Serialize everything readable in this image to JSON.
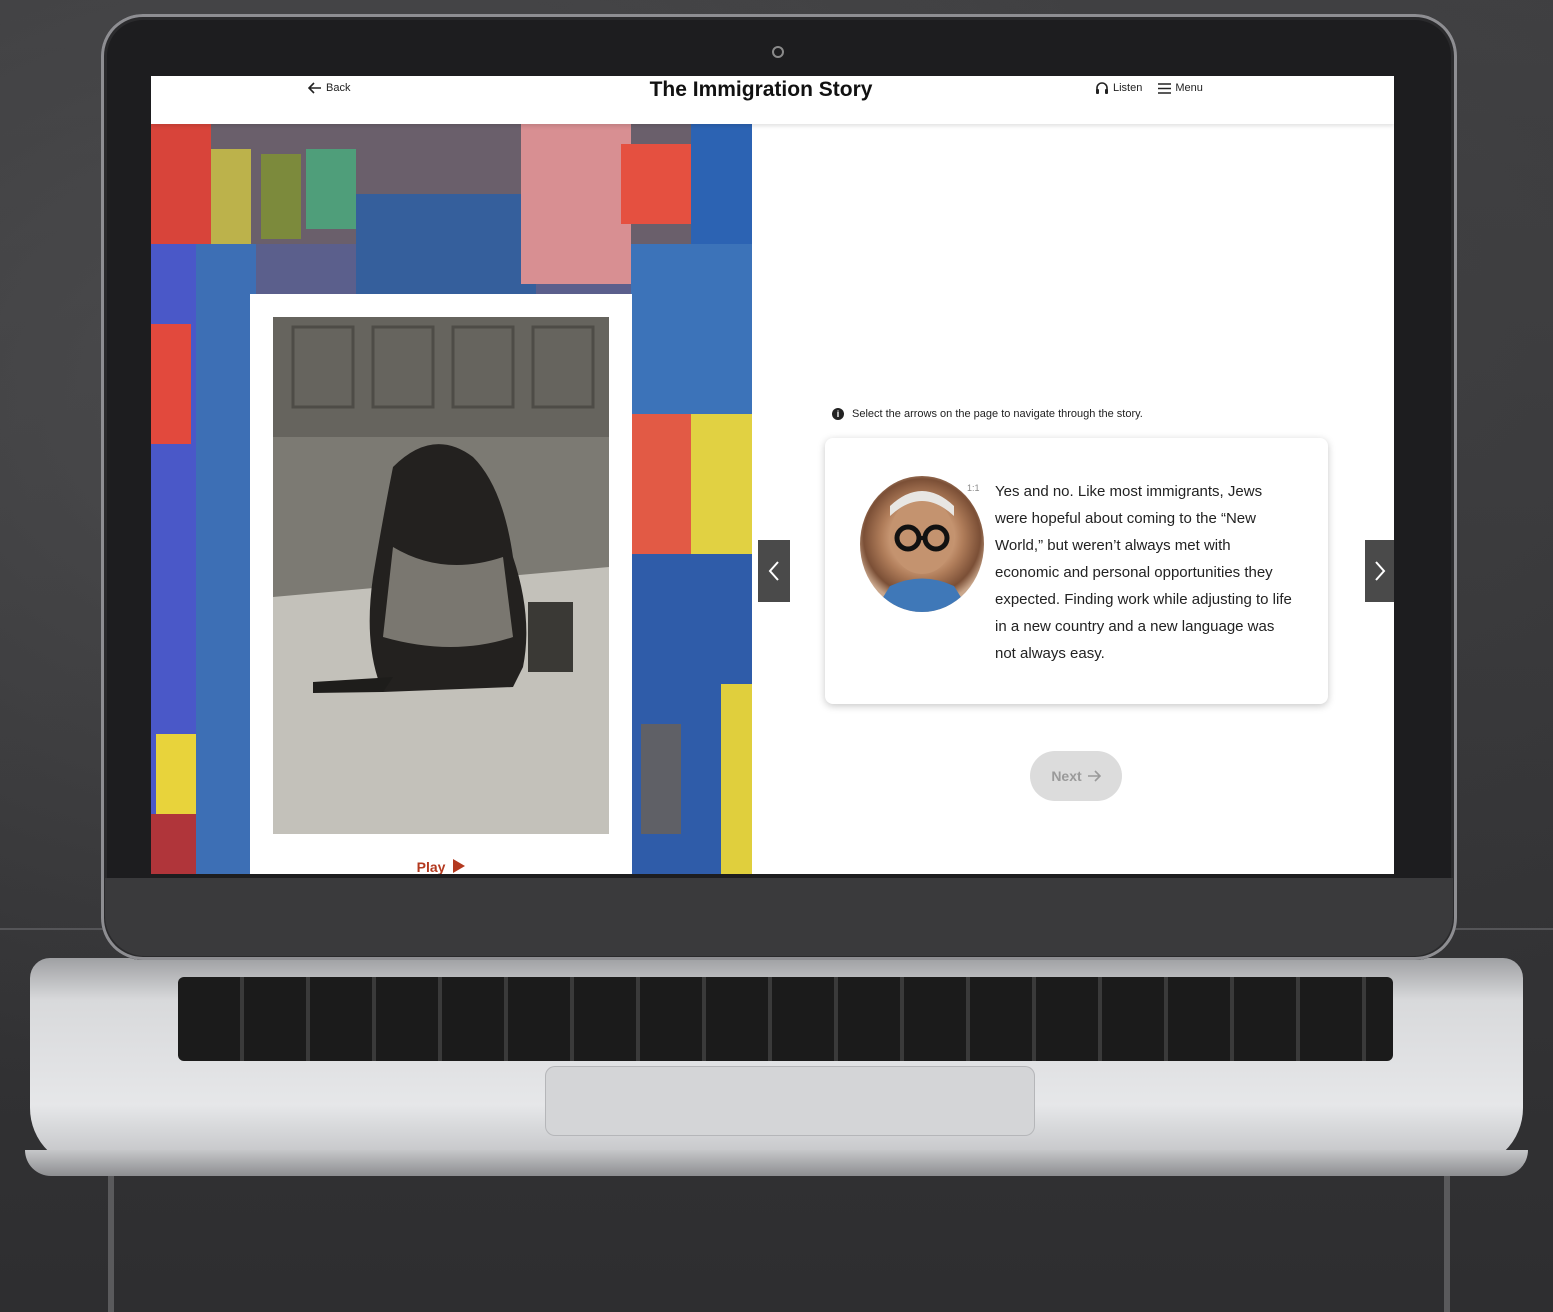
{
  "header": {
    "back_label": "Back",
    "title": "The Immigration Story",
    "listen_label": "Listen",
    "menu_label": "Menu"
  },
  "media_card": {
    "play_label": "Play"
  },
  "content": {
    "hint_text": "Select the arrows on the page to navigate through the story.",
    "timestamp": "1:1",
    "quote": "Yes and no. Like most immigrants, Jews were hopeful about coming to the “New World,” but weren’t always met with economic and personal opportunities they expected. Finding work while adjusting to life in a new country and a new language was not always easy.",
    "next_label": "Next"
  },
  "icons": {
    "back": "arrow-left-icon",
    "listen": "headphones-icon",
    "menu": "hamburger-icon",
    "info": "info-icon",
    "play": "play-triangle-icon",
    "prev": "chevron-left-icon",
    "next_arrow": "chevron-right-icon"
  },
  "colors": {
    "play_accent": "#b3391f",
    "arrow_bg": "#4a4a4a",
    "next_disabled_bg": "#dcdcdc"
  }
}
